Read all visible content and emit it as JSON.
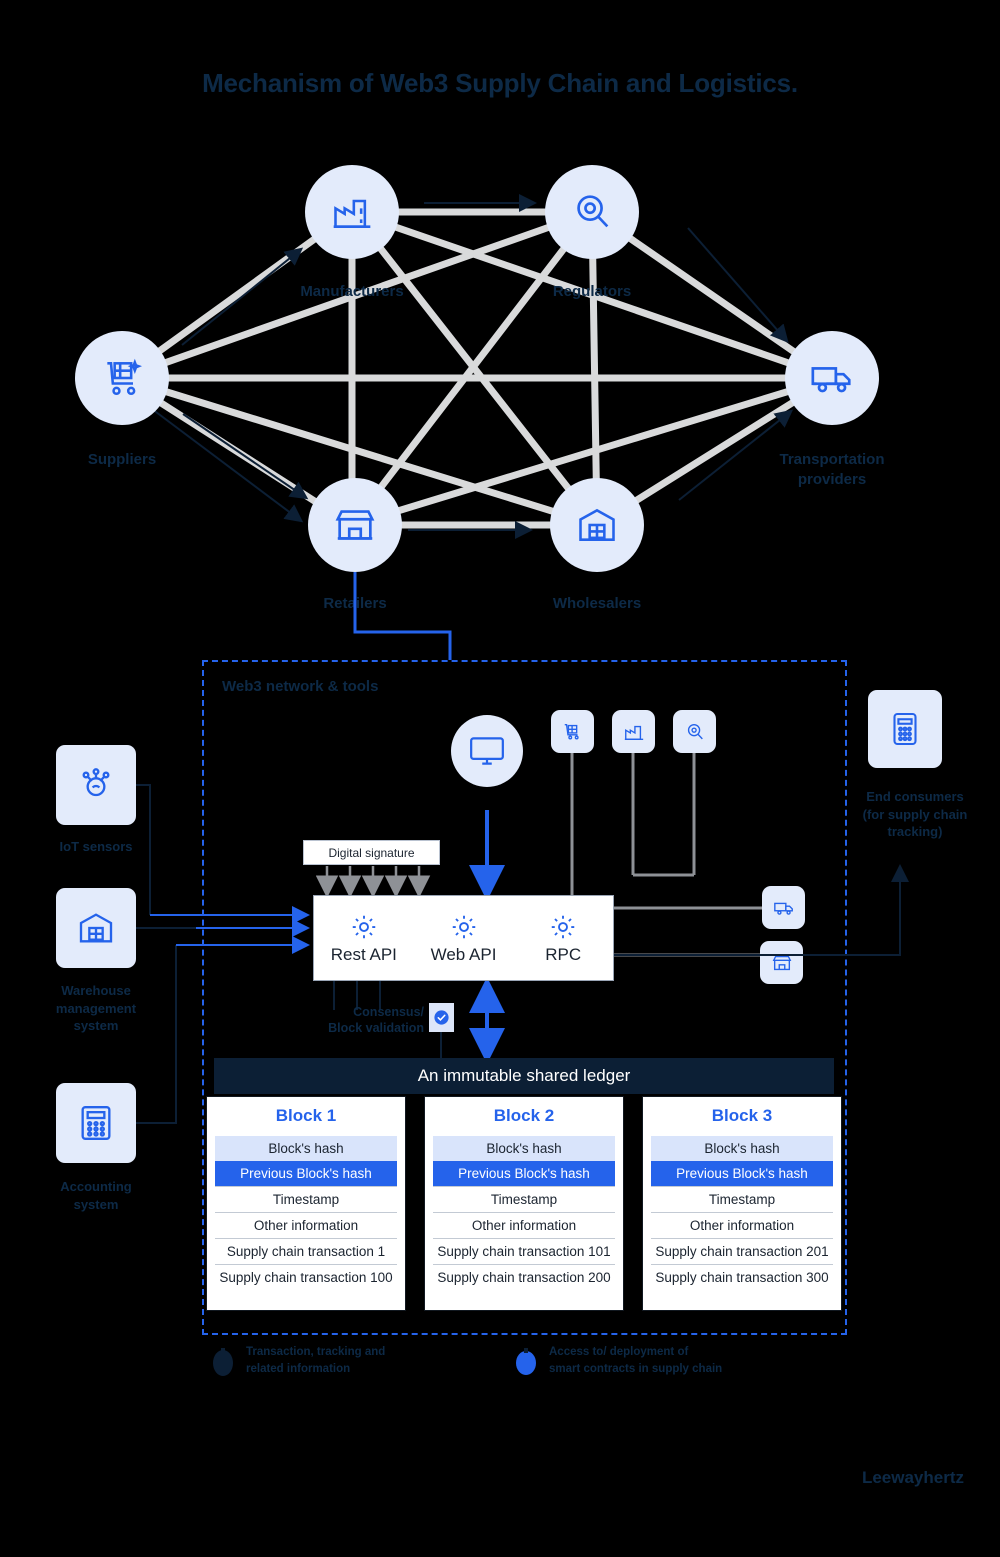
{
  "title": "Mechanism of Web3 Supply Chain and Logistics.",
  "watermark": "Leewayhertz",
  "network": {
    "nodes": [
      {
        "id": "manufacturers",
        "label": "Manufacturers",
        "icon": "factory-icon"
      },
      {
        "id": "regulators",
        "label": "Regulators",
        "icon": "magnifier-icon"
      },
      {
        "id": "suppliers",
        "label": "Suppliers",
        "icon": "cart-icon"
      },
      {
        "id": "transportation",
        "label": "Transportation providers",
        "icon": "truck-icon"
      },
      {
        "id": "retailers",
        "label": "Retailers",
        "icon": "store-icon"
      },
      {
        "id": "wholesalers",
        "label": "Wholesalers",
        "icon": "warehouse-icon"
      }
    ]
  },
  "container": {
    "label": "Web3 network & tools"
  },
  "digital_signature": {
    "label": "Digital signature"
  },
  "api": {
    "items": [
      {
        "label": "Rest API",
        "icon": "gear-icon"
      },
      {
        "label": "Web API",
        "icon": "gear-icon"
      },
      {
        "label": "RPC",
        "icon": "gear-icon"
      }
    ]
  },
  "consensus": {
    "label": "Consensus/\nBlock validation",
    "badge_icon": "check-badge-icon"
  },
  "ledger": {
    "header": "An immutable shared ledger",
    "blocks": [
      {
        "title": "Block 1",
        "rows": [
          "Block's hash",
          "Previous Block's hash",
          "Timestamp",
          "Other information",
          "Supply chain transaction 1",
          "Supply chain transaction 100"
        ]
      },
      {
        "title": "Block 2",
        "rows": [
          "Block's hash",
          "Previous Block's hash",
          "Timestamp",
          "Other information",
          "Supply chain transaction 101",
          "Supply chain transaction 200"
        ]
      },
      {
        "title": "Block 3",
        "rows": [
          "Block's hash",
          "Previous Block's hash",
          "Timestamp",
          "Other information",
          "Supply chain transaction 201",
          "Supply chain transaction 300"
        ]
      }
    ]
  },
  "left_systems": [
    {
      "id": "iot",
      "label": "IoT sensors",
      "icon": "iot-sensor-icon"
    },
    {
      "id": "wms",
      "label": "Warehouse\nmanagement\nsystem",
      "icon": "warehouse-icon"
    },
    {
      "id": "accounting",
      "label": "Accounting\nsystem",
      "icon": "calculator-icon"
    }
  ],
  "right_systems": [
    {
      "id": "consumers",
      "label": "End consumers\n(for supply chain\ntracking)",
      "icon": "mobile-icon"
    }
  ],
  "legend": [
    {
      "marker": "node-marker",
      "color": "#0c1f35",
      "text": "Transaction, tracking and\nrelated information"
    },
    {
      "marker": "dot-marker",
      "color": "#2563eb",
      "text": "Access to/ deployment of\nsmart contracts in supply chain"
    }
  ],
  "colors": {
    "accent": "#2563eb",
    "dark": "#0c1f35",
    "node_bg": "#e3ebfb",
    "edge": "#d9dadb",
    "background": "#000000"
  }
}
